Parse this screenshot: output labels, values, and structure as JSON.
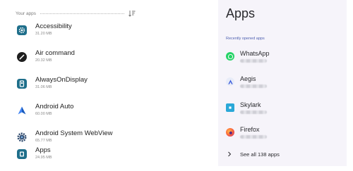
{
  "left_panel": {
    "header": {
      "title": "Your apps",
      "sort_icon": "sort-icon"
    },
    "apps": [
      {
        "name": "Accessibility",
        "size": "31.20 MB",
        "icon": "accessibility-gear-icon"
      },
      {
        "name": "Air command",
        "size": "20.32 MB",
        "icon": "pen-icon"
      },
      {
        "name": "AlwaysOnDisplay",
        "size": "31.06 MB",
        "icon": "always-on-display-icon"
      },
      {
        "name": "Android Auto",
        "size": "60.00 MB",
        "icon": "android-auto-icon"
      },
      {
        "name": "Android System WebView",
        "size": "65.77 MB",
        "icon": "webview-gear-icon"
      },
      {
        "name": "Apps",
        "size": "24.95 MB",
        "icon": "apps-icon"
      }
    ]
  },
  "right_panel": {
    "title": "Apps",
    "section_label": "Recently opened apps",
    "recent_apps": [
      {
        "name": "WhatsApp",
        "icon": "whatsapp-icon"
      },
      {
        "name": "Aegis",
        "icon": "aegis-icon"
      },
      {
        "name": "Skylark",
        "icon": "skylark-icon"
      },
      {
        "name": "Firefox",
        "icon": "firefox-icon"
      }
    ],
    "see_all_label": "See all 138 apps"
  },
  "colors": {
    "accent_blue": "#4e5fb0",
    "whatsapp_green": "#25d366",
    "icon_teal": "#1f6f8b",
    "right_background": "#f6f4fa"
  }
}
